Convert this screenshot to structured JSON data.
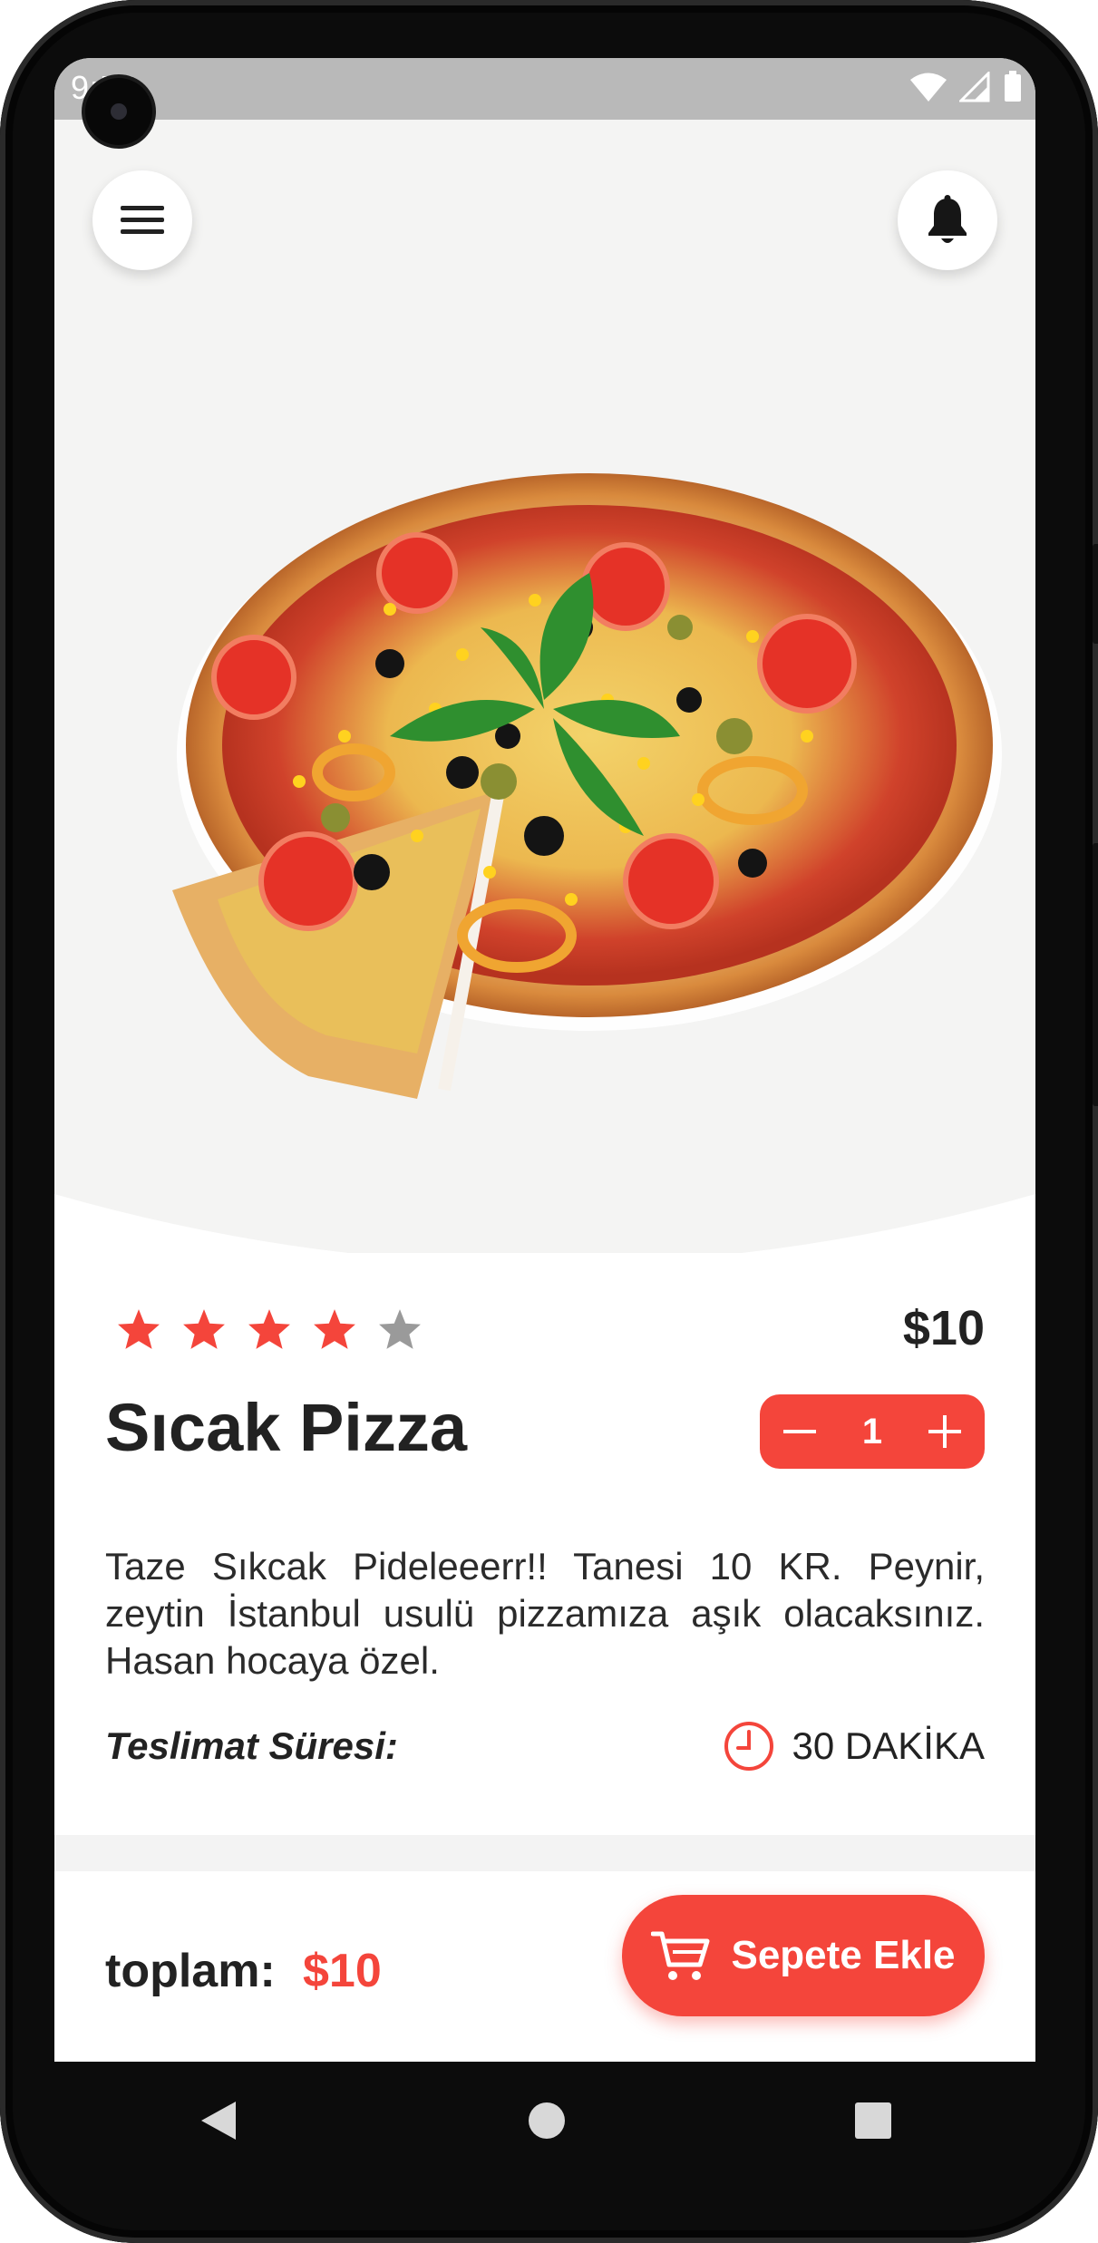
{
  "status_bar": {
    "time": "9:58"
  },
  "header": {
    "menu_icon": "hamburger-menu-icon",
    "notification_icon": "bell-icon"
  },
  "product": {
    "rating": 4,
    "rating_max": 5,
    "price": "$10",
    "name": "Sıcak Pizza",
    "quantity": "1",
    "description": "Taze Sıkcak Pideleeerr!! Tanesi 10 KR. Peynir, zeytin İstanbul usulü pizzamıza aşık olacaksınız. Hasan hocaya özel.",
    "delivery_label": "Teslimat Süresi:",
    "delivery_time": "30 DAKİKA"
  },
  "footer": {
    "total_label": "toplam:",
    "total_value": "$10",
    "add_to_cart_label": "Sepete Ekle"
  },
  "colors": {
    "accent": "#f4453b",
    "star_active": "#f4453b",
    "star_inactive": "#9a9a9a",
    "hero_bg": "#f4f4f3"
  }
}
